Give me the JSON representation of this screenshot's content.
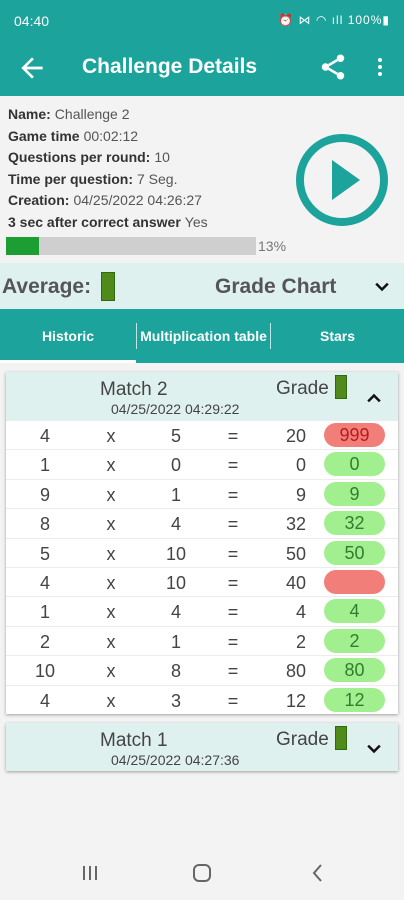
{
  "status_bar": {
    "time": "04:40",
    "icons": "⏰ ⋈ ◠ ıll 100%▮"
  },
  "app_bar": {
    "title": "Challenge Details",
    "back_icon": "arrow-left-icon",
    "share_icon": "share-icon",
    "more_icon": "more-vertical-icon"
  },
  "info": {
    "name_label": "Name:",
    "name_value": "Challenge 2",
    "game_time_label": "Game time",
    "game_time_value": "00:02:12",
    "qpr_label": "Questions per round:",
    "qpr_value": "10",
    "tpq_label": "Time per question:",
    "tpq_value": "7 Seg.",
    "creation_label": "Creation:",
    "creation_value": "04/25/2022 04:26:27",
    "after_label": "3 sec after correct answer",
    "after_value": "Yes"
  },
  "progress": {
    "percent": 13,
    "label": "13%"
  },
  "average": {
    "label": "Average:",
    "grade_chart": "Grade Chart"
  },
  "tabs": [
    {
      "label": "Historic"
    },
    {
      "label": "Multiplication table"
    },
    {
      "label": "Stars"
    }
  ],
  "matches": [
    {
      "title": "Match  2",
      "date": "04/25/2022 04:29:22",
      "grade_label": "Grade",
      "expanded": true,
      "rows": [
        {
          "a": "4",
          "op": "x",
          "b": "5",
          "eq": "=",
          "result": "20",
          "answer": "999",
          "correct": false
        },
        {
          "a": "1",
          "op": "x",
          "b": "0",
          "eq": "=",
          "result": "0",
          "answer": "0",
          "correct": true
        },
        {
          "a": "9",
          "op": "x",
          "b": "1",
          "eq": "=",
          "result": "9",
          "answer": "9",
          "correct": true
        },
        {
          "a": "8",
          "op": "x",
          "b": "4",
          "eq": "=",
          "result": "32",
          "answer": "32",
          "correct": true
        },
        {
          "a": "5",
          "op": "x",
          "b": "10",
          "eq": "=",
          "result": "50",
          "answer": "50",
          "correct": true
        },
        {
          "a": "4",
          "op": "x",
          "b": "10",
          "eq": "=",
          "result": "40",
          "answer": "",
          "correct": false
        },
        {
          "a": "1",
          "op": "x",
          "b": "4",
          "eq": "=",
          "result": "4",
          "answer": "4",
          "correct": true
        },
        {
          "a": "2",
          "op": "x",
          "b": "1",
          "eq": "=",
          "result": "2",
          "answer": "2",
          "correct": true
        },
        {
          "a": "10",
          "op": "x",
          "b": "8",
          "eq": "=",
          "result": "80",
          "answer": "80",
          "correct": true
        },
        {
          "a": "4",
          "op": "x",
          "b": "3",
          "eq": "=",
          "result": "12",
          "answer": "12",
          "correct": true
        }
      ]
    },
    {
      "title": "Match  1",
      "date": "04/25/2022 04:27:36",
      "grade_label": "Grade",
      "expanded": false,
      "rows": []
    }
  ],
  "colors": {
    "primary": "#1ba39c",
    "header_tint": "#dff1ee",
    "correct_bg": "#a2ef8f",
    "wrong_bg": "#f27e7a",
    "grade_marker": "#4f8a1b",
    "progress_fill": "#1c9e33"
  }
}
